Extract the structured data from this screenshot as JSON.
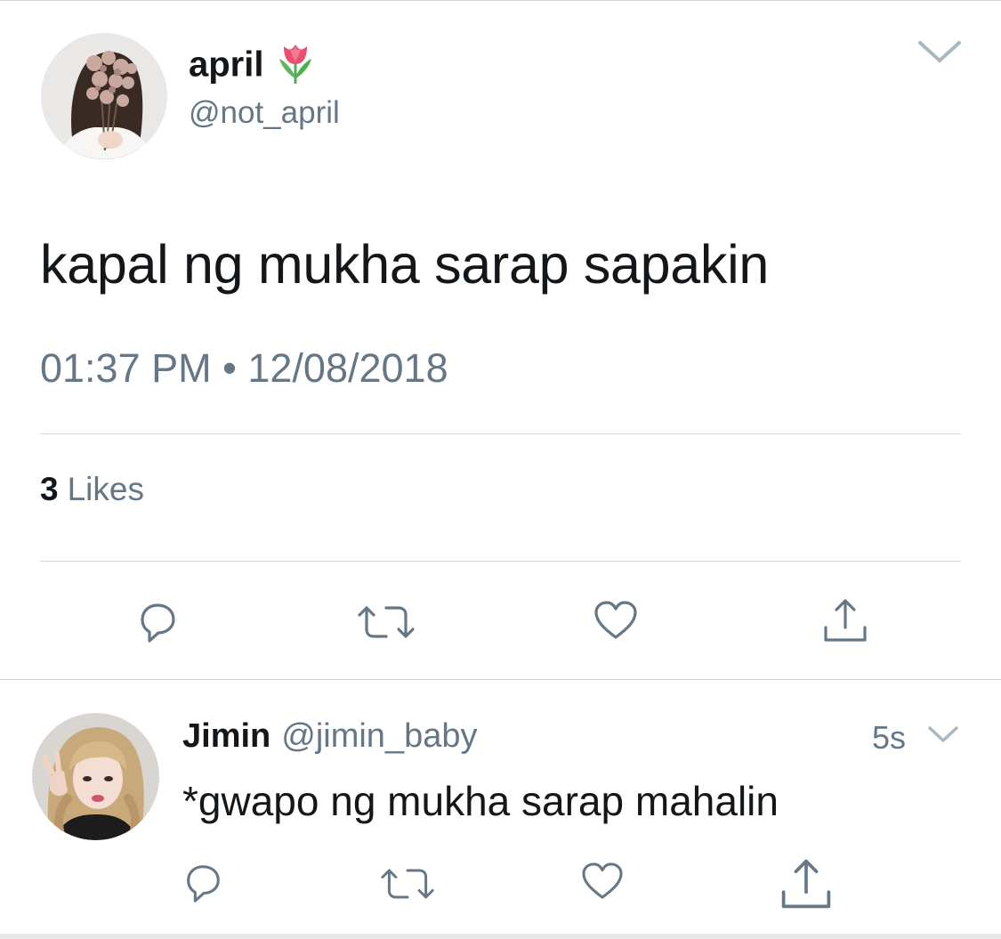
{
  "tweet": {
    "display_name": "april",
    "name_emoji": "tulip-emoji",
    "handle": "@not_april",
    "text": "kapal ng mukha sarap sapakin",
    "timestamp": "01:37 PM • 12/08/2018",
    "likes_count": "3",
    "likes_label": "Likes",
    "actions": [
      "reply-icon",
      "retweet-icon",
      "like-icon",
      "share-icon"
    ]
  },
  "reply": {
    "display_name": "Jimin",
    "handle": "@jimin_baby",
    "time": "5s",
    "text": "*gwapo ng mukha sarap mahalin",
    "actions": [
      "reply-icon",
      "retweet-icon",
      "like-icon",
      "share-icon"
    ]
  },
  "colors": {
    "text_primary": "#14171a",
    "text_secondary": "#657786",
    "divider": "#d4d6d8"
  }
}
